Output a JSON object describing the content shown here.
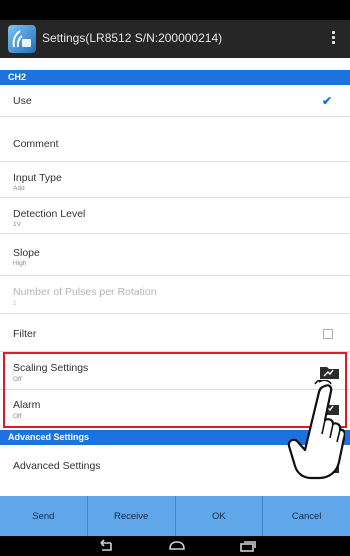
{
  "app": {
    "title": "Settings(LR8512 S/N:200000214)"
  },
  "sections": {
    "ch2": "CH2",
    "advanced": "Advanced Settings"
  },
  "rows": {
    "use": {
      "label": "Use",
      "checked": true
    },
    "comment": {
      "label": "Comment"
    },
    "input_type": {
      "label": "Input Type",
      "value": "Add"
    },
    "detection_level": {
      "label": "Detection Level",
      "value": "1V"
    },
    "slope": {
      "label": "Slope",
      "value": "High"
    },
    "pulses": {
      "label": "Number of Pulses per Rotation",
      "value": "1"
    },
    "filter": {
      "label": "Filter",
      "checked": false
    },
    "scaling": {
      "label": "Scaling Settings",
      "value": "Off"
    },
    "alarm": {
      "label": "Alarm",
      "value": "Off"
    },
    "advanced_settings": {
      "label": "Advanced Settings"
    }
  },
  "buttons": {
    "send": "Send",
    "receive": "Receive",
    "ok": "OK",
    "cancel": "Cancel"
  },
  "icons": {
    "app": "wireless-logger-icon",
    "overflow": "overflow-menu-icon",
    "folder": "folder-icon",
    "back": "back-icon",
    "home": "home-icon",
    "recents": "recents-icon",
    "hand": "pointing-hand-icon"
  },
  "colors": {
    "accent": "#1c73df",
    "button_bar": "#60a7e9",
    "highlight": "#e0192c"
  }
}
